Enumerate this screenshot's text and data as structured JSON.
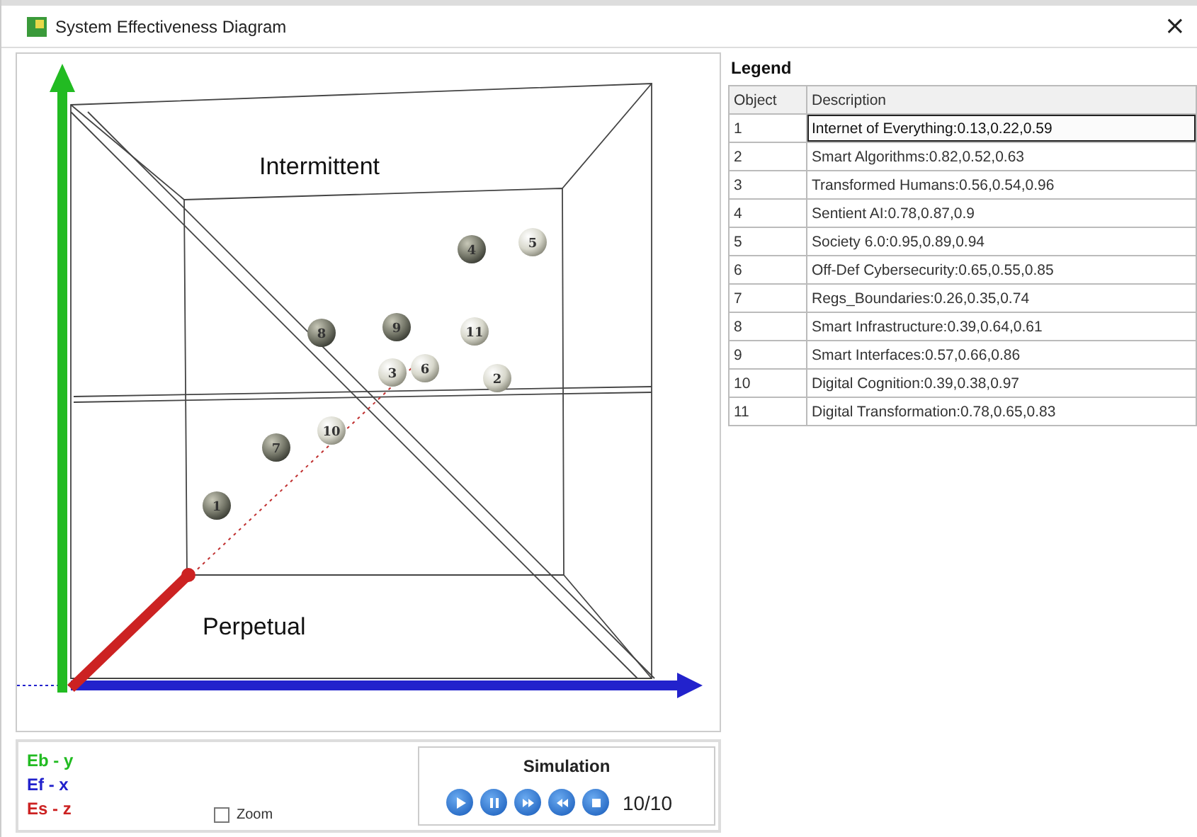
{
  "window": {
    "title": "System Effectiveness Diagram",
    "close": "×"
  },
  "plot": {
    "regions": [
      {
        "label": "Intermittent"
      },
      {
        "label": "Perpetual"
      }
    ],
    "objects": [
      {
        "label": "1"
      },
      {
        "label": "2"
      },
      {
        "label": "3"
      },
      {
        "label": "4"
      },
      {
        "label": "5"
      },
      {
        "label": "6"
      },
      {
        "label": "7"
      },
      {
        "label": "8"
      },
      {
        "label": "9"
      },
      {
        "label": "10"
      },
      {
        "label": "11"
      }
    ]
  },
  "legend": {
    "title": "Legend",
    "columns": [
      "Object",
      "Description"
    ],
    "rows": [
      {
        "object": "1",
        "description": "Internet of Everything:0.13,0.22,0.59",
        "selected": true
      },
      {
        "object": "2",
        "description": "Smart Algorithms:0.82,0.52,0.63",
        "selected": false
      },
      {
        "object": "3",
        "description": "Transformed Humans:0.56,0.54,0.96",
        "selected": false
      },
      {
        "object": "4",
        "description": "Sentient AI:0.78,0.87,0.9",
        "selected": false
      },
      {
        "object": "5",
        "description": "Society 6.0:0.95,0.89,0.94",
        "selected": false
      },
      {
        "object": "6",
        "description": "Off-Def Cybersecurity:0.65,0.55,0.85",
        "selected": false
      },
      {
        "object": "7",
        "description": "Regs_Boundaries:0.26,0.35,0.74",
        "selected": false
      },
      {
        "object": "8",
        "description": "Smart Infrastructure:0.39,0.64,0.61",
        "selected": false
      },
      {
        "object": "9",
        "description": "Smart Interfaces:0.57,0.66,0.86",
        "selected": false
      },
      {
        "object": "10",
        "description": "Digital Cognition:0.39,0.38,0.97",
        "selected": false
      },
      {
        "object": "11",
        "description": "Digital Transformation:0.78,0.65,0.83",
        "selected": false
      }
    ]
  },
  "axes": [
    {
      "label": "Eb - y",
      "color": "#22bb22"
    },
    {
      "label": "Ef - x",
      "color": "#2222cc"
    },
    {
      "label": "Es - z",
      "color": "#cc2222"
    }
  ],
  "zoom": {
    "label": "Zoom",
    "checked": false
  },
  "simulation": {
    "title": "Simulation",
    "buttons": [
      {
        "kind": "play"
      },
      {
        "kind": "pause"
      },
      {
        "kind": "forward"
      },
      {
        "kind": "rewind"
      },
      {
        "kind": "stop"
      }
    ],
    "counter": "10/10"
  }
}
